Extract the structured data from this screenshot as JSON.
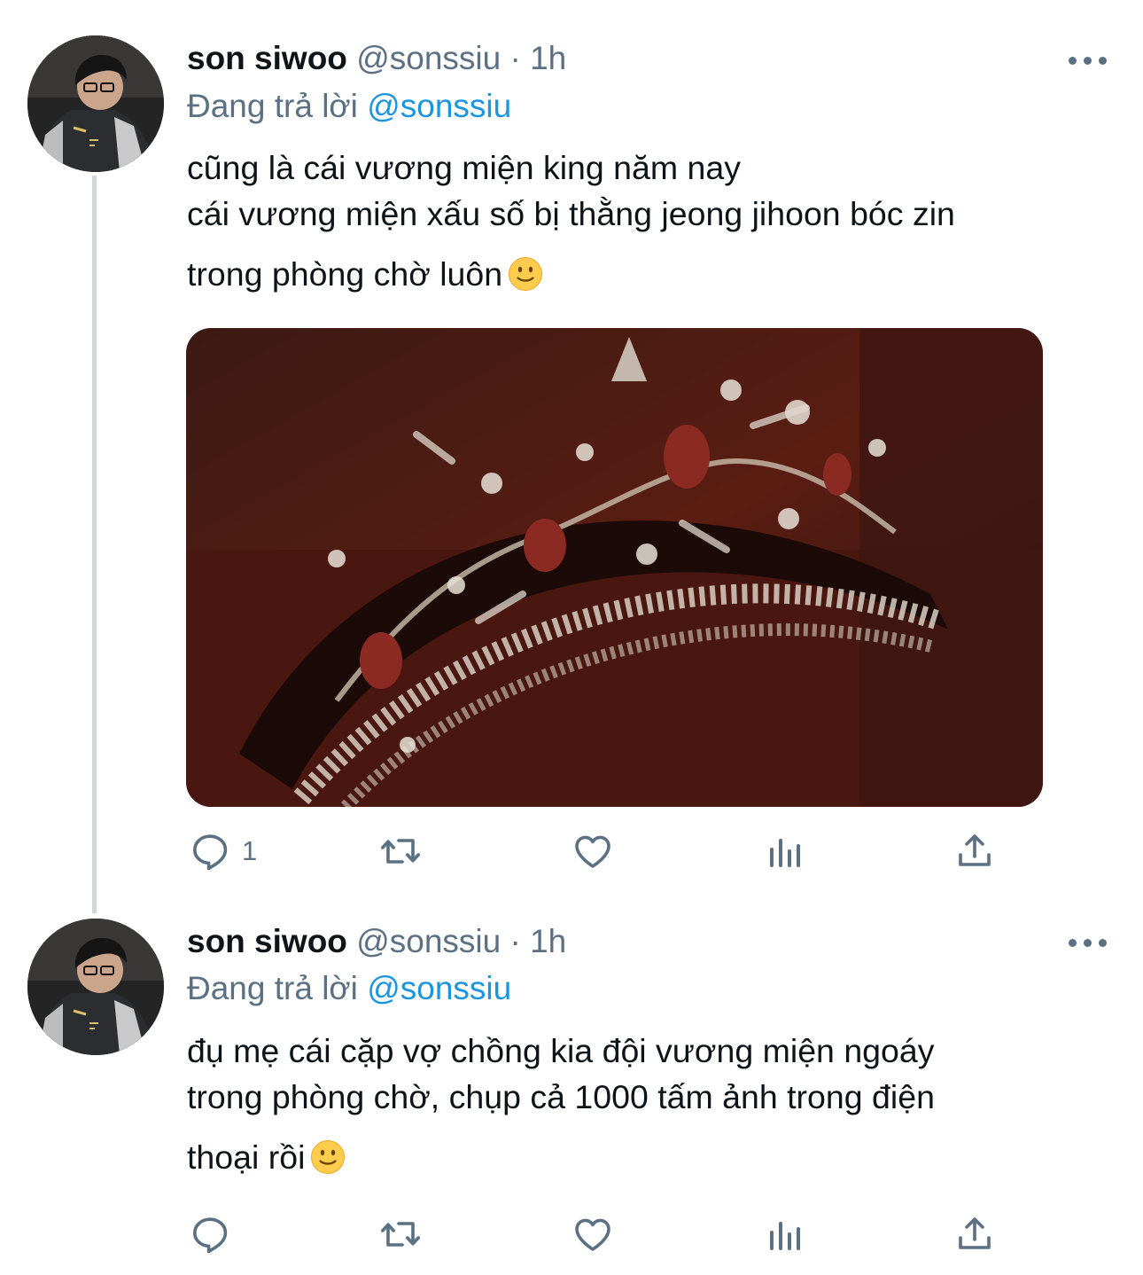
{
  "tweets": [
    {
      "display_name": "son siwoo",
      "handle": "@sonssiu",
      "separator": "·",
      "time": "1h",
      "replying_prefix": "Đang trả lời",
      "replying_to": "@sonssiu",
      "text_lines": [
        "cũng là cái vương miện king năm nay",
        "cái vương miện xấu số bị thằng jeong jihoon bóc zin",
        "trong phòng chờ luôn"
      ],
      "emoji": "slightly-smiling-face",
      "has_media": true,
      "media_subject": "crown-photo",
      "actions": {
        "reply_count": "1",
        "retweet_count": "",
        "like_count": ""
      }
    },
    {
      "display_name": "son siwoo",
      "handle": "@sonssiu",
      "separator": "·",
      "time": "1h",
      "replying_prefix": "Đang trả lời",
      "replying_to": "@sonssiu",
      "text_lines": [
        "đụ mẹ cái cặp vợ chồng kia đội vương miện ngoáy",
        "trong phòng chờ, chụp cả 1000 tấm ảnh trong điện",
        "thoại rồi"
      ],
      "emoji": "slightly-smiling-face",
      "has_media": false,
      "actions": {
        "reply_count": "",
        "retweet_count": "",
        "like_count": ""
      }
    }
  ],
  "icons": {
    "reply": "speech-bubble-icon",
    "retweet": "retweet-arrows-icon",
    "like": "heart-icon",
    "analytics": "bar-chart-icon",
    "share": "share-upload-icon",
    "more": "more-dots-icon"
  },
  "colors": {
    "text_primary": "#0f1419",
    "text_secondary": "#5b7083",
    "link": "#1b95e0",
    "thread_line": "#d4d7da",
    "emoji_yellow": "#ffcc4d"
  }
}
